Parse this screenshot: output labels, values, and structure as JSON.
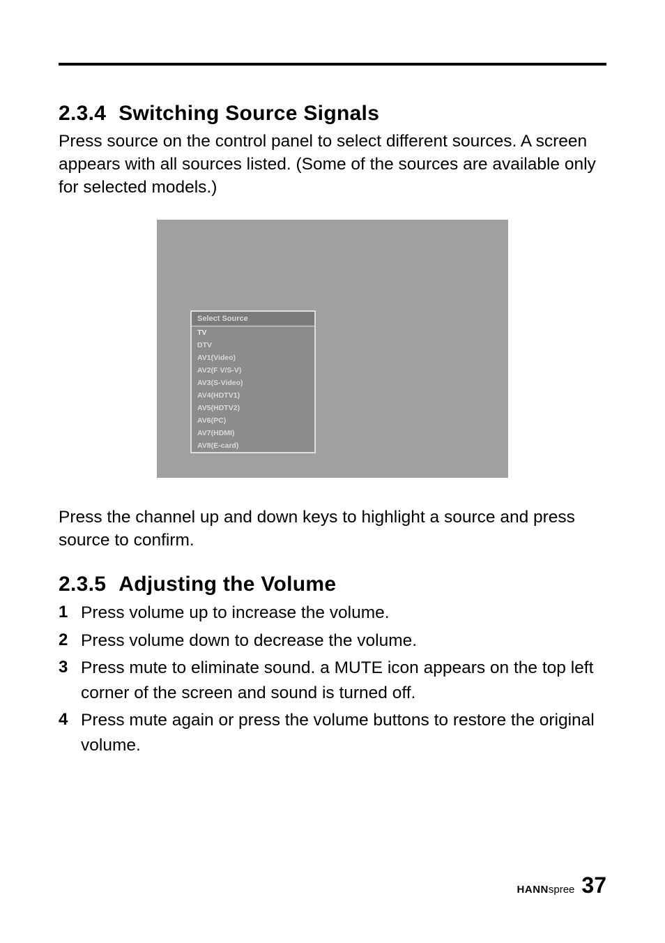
{
  "sections": {
    "switching": {
      "number": "2.3.4",
      "title": "Switching Source Signals",
      "paragraph": "Press source on the control panel to select different sources. A screen appears with all sources listed. (Some of the sources are available only for selected models.)",
      "after_paragraph": "Press the channel up and down keys to highlight a source and press source to confirm."
    },
    "volume": {
      "number": "2.3.5",
      "title": "Adjusting the Volume",
      "steps": [
        "Press volume up to increase the volume.",
        "Press volume down to decrease the volume.",
        "Press mute to eliminate sound. a MUTE icon appears on the top left corner of the screen and sound is turned off.",
        "Press mute again or press the volume buttons to restore the original volume."
      ]
    }
  },
  "osd_menu": {
    "title": "Select Source",
    "items": [
      "TV",
      "DTV",
      "AV1(Video)",
      "AV2(F V/S-V)",
      "AV3(S-Video)",
      "AV4(HDTV1)",
      "AV5(HDTV2)",
      "AV6(PC)",
      "AV7(HDMI)",
      "AV8(E-card)"
    ]
  },
  "footer": {
    "brand_bold": "HANN",
    "brand_light": "spree",
    "page": "37"
  }
}
